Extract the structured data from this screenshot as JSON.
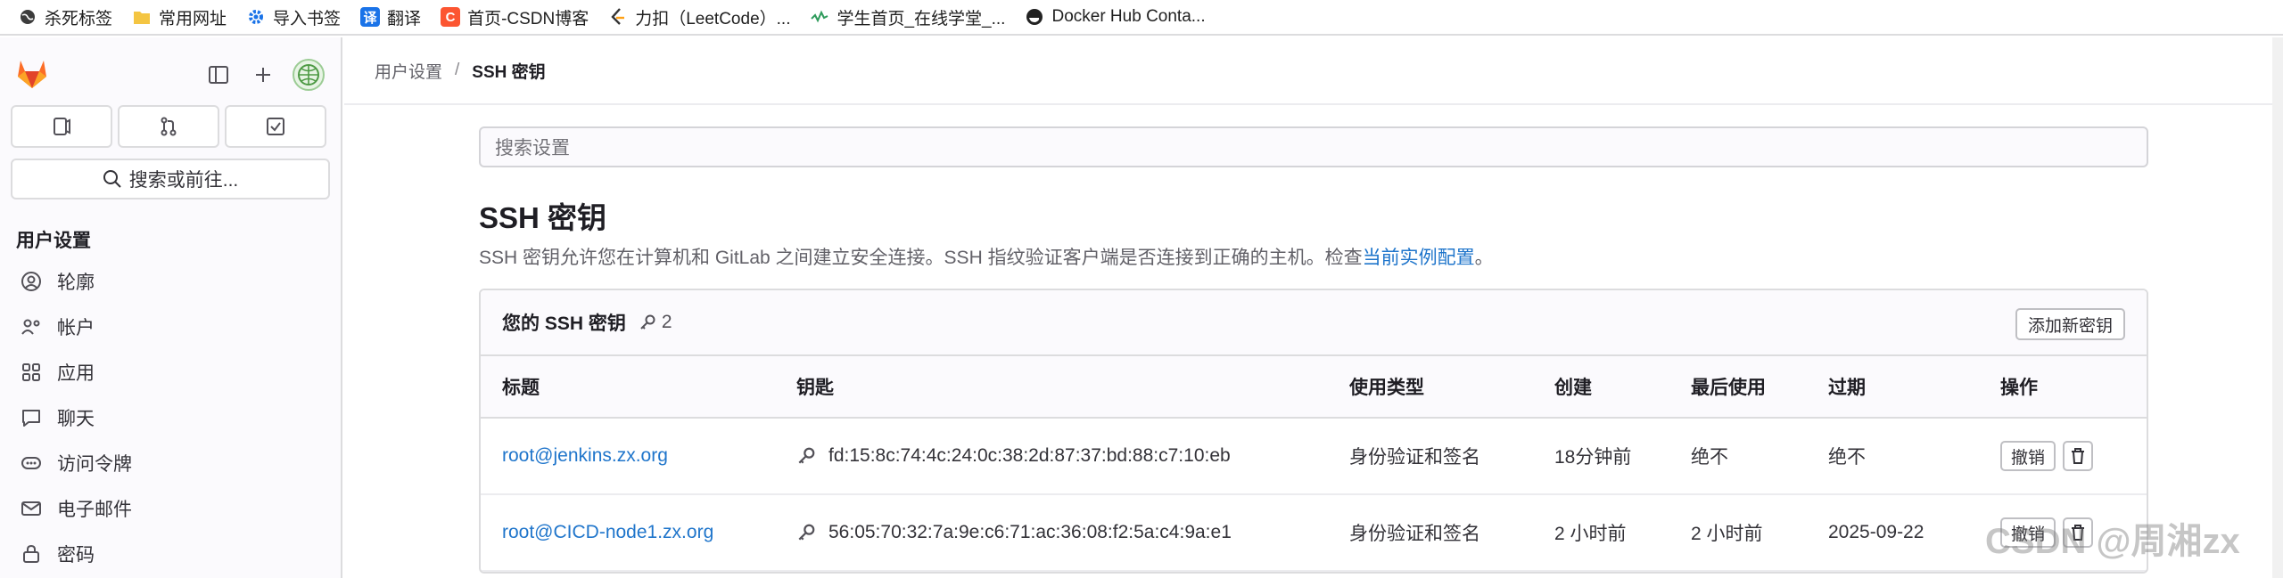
{
  "bookmarks": [
    {
      "label": "杀死标签",
      "icon": "globe-icon",
      "color": "#333333"
    },
    {
      "label": "常用网址",
      "icon": "folder-icon",
      "color": "#f4c542"
    },
    {
      "label": "导入书签",
      "icon": "gear-icon",
      "color": "#1a73e8"
    },
    {
      "label": "翻译",
      "icon": "translate-icon",
      "color": "#1a73e8"
    },
    {
      "label": "首页-CSDN博客",
      "icon": "csdn-icon",
      "color": "#fc5531"
    },
    {
      "label": "力扣（LeetCode）...",
      "icon": "leetcode-icon",
      "color": "#ffa116"
    },
    {
      "label": "学生首页_在线学堂_...",
      "icon": "chart-icon",
      "color": "#2e9b5b"
    },
    {
      "label": "Docker Hub Conta...",
      "icon": "docker-icon",
      "color": "#222222"
    }
  ],
  "sidebar": {
    "search_label": "搜索或前往...",
    "section_title": "用户设置",
    "items": [
      {
        "label": "轮廓",
        "icon": "user-circle-icon"
      },
      {
        "label": "帐户",
        "icon": "account-icon"
      },
      {
        "label": "应用",
        "icon": "apps-icon"
      },
      {
        "label": "聊天",
        "icon": "chat-icon"
      },
      {
        "label": "访问令牌",
        "icon": "token-icon"
      },
      {
        "label": "电子邮件",
        "icon": "mail-icon"
      },
      {
        "label": "密码",
        "icon": "lock-icon"
      }
    ]
  },
  "breadcrumb": {
    "parent": "用户设置",
    "separator": "/",
    "current": "SSH 密钥"
  },
  "settings_search": {
    "placeholder": "搜索设置"
  },
  "page": {
    "title": "SSH 密钥",
    "description": "SSH 密钥允许您在计算机和 GitLab 之间建立安全连接。SSH 指纹验证客户端是否连接到正确的主机。检查",
    "description_link": "当前实例配置",
    "description_end": "。"
  },
  "keys_card": {
    "title": "您的 SSH 密钥",
    "count": "2",
    "add_button": "添加新密钥",
    "columns": [
      "标题",
      "钥匙",
      "使用类型",
      "创建",
      "最后使用",
      "过期",
      "操作"
    ],
    "rows": [
      {
        "title": "root@jenkins.zx.org",
        "fingerprint": "fd:15:8c:74:4c:24:0c:38:2d:87:37:bd:88:c7:10:eb",
        "usage": "身份验证和签名",
        "created": "18分钟前",
        "last_used": "绝不",
        "expires": "绝不",
        "revoke": "撤销"
      },
      {
        "title": "root@CICD-node1.zx.org",
        "fingerprint": "56:05:70:32:7a:9e:c6:71:ac:36:08:f2:5a:c4:9a:e1",
        "usage": "身份验证和签名",
        "created": "2 小时前",
        "last_used": "2 小时前",
        "expires": "2025-09-22",
        "revoke": "撤销"
      }
    ]
  },
  "watermark": "CSDN @周湘zx",
  "colors": {
    "link": "#1f75cb",
    "gitlab_orange": "#fc6d26",
    "border": "#dcdcde"
  }
}
